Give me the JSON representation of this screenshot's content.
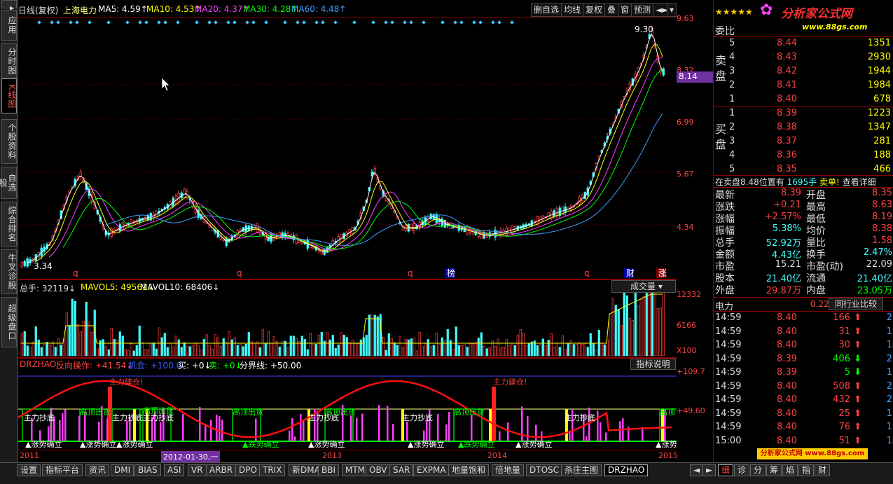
{
  "leftbar": [
    {
      "label": "应用"
    },
    {
      "label": "分时图"
    },
    {
      "label": "K线图"
    },
    {
      "label": "个股资料"
    },
    {
      "label": "自选股"
    },
    {
      "label": "综合排名"
    },
    {
      "label": "牛叉诊股"
    },
    {
      "label": "超级盘口"
    }
  ],
  "header": {
    "period": "日线(复权)",
    "stock": "上海电力",
    "ma": [
      {
        "text": "MA5: 4.59↑",
        "color": "#ffffff"
      },
      {
        "text": "MA10: 4.53↑",
        "color": "#ffff00"
      },
      {
        "text": "MA20: 4.37↑",
        "color": "#ff40ff"
      },
      {
        "text": "MA30: 4.28↑",
        "color": "#00ff00"
      },
      {
        "text": "MA60: 4.48↑",
        "color": "#40a0ff"
      }
    ],
    "buttons": [
      "删自选",
      "均线",
      "复权",
      "叠",
      "窗",
      "预测"
    ]
  },
  "main_axis": [
    "9.63",
    "8.32",
    "6.99",
    "5.67",
    "4.34"
  ],
  "current_price_tag": "8.14",
  "max_label": "9.30",
  "min_label": "3.34",
  "markers": [
    "q",
    "q",
    "q",
    "榜",
    "q",
    "财",
    "涨"
  ],
  "volume": {
    "title_total": "总手: 32119↓",
    "mavol5": "MAVOL5: 49561↓",
    "mavol10": "MAVOL10: 68406↓",
    "selector": "成交量",
    "axis": [
      "12332",
      "6166",
      "X100"
    ]
  },
  "indicator": {
    "name": "DRZHAO",
    "op": "反向操作: +41.54↓",
    "opp": "机会: +100.0",
    "buy": "买: +0↓",
    "sell": "卖: +0↓",
    "boundary": "分界线: +50.00",
    "button": "指标说明",
    "axis": [
      "+109.7",
      "+49.60"
    ],
    "labels": [
      "主力建仓!",
      "主力建仓!",
      "高顶出货",
      "高顶出货",
      "高顶出货",
      "高顶出货",
      "高顶出货",
      "高顶",
      "主力抄底",
      "主力抄底",
      "主力抄底",
      "主力抄底",
      "主力抄底",
      "主力抄底",
      "跌势确立",
      "涨势确立",
      "涨势确立",
      "跌势确立",
      "涨势确立",
      "涨势确立",
      "涨势确立",
      "涨势确立",
      "涨势"
    ]
  },
  "dates": [
    "2011",
    "2012-01-30,一",
    "2013",
    "2014",
    "2015"
  ],
  "right": {
    "logo": "分析家公式网",
    "logo_url": "www.88gs.com",
    "weibi_label": "委比",
    "sell_label": "卖盘",
    "buy_label": "买盘",
    "asks": [
      {
        "lvl": "5",
        "price": "8.44",
        "vol": "1351"
      },
      {
        "lvl": "4",
        "price": "8.43",
        "vol": "2930"
      },
      {
        "lvl": "3",
        "price": "8.42",
        "vol": "1944"
      },
      {
        "lvl": "2",
        "price": "8.41",
        "vol": "1984"
      },
      {
        "lvl": "1",
        "price": "8.40",
        "vol": "678"
      }
    ],
    "bids": [
      {
        "lvl": "1",
        "price": "8.39",
        "vol": "1223"
      },
      {
        "lvl": "2",
        "price": "8.38",
        "vol": "1347"
      },
      {
        "lvl": "3",
        "price": "8.37",
        "vol": "281"
      },
      {
        "lvl": "4",
        "price": "8.36",
        "vol": "188"
      },
      {
        "lvl": "5",
        "price": "8.35",
        "vol": "466"
      }
    ],
    "note": "在卖盘8.48位置有",
    "note_vol": "1695手",
    "note_sell": "卖单!",
    "note_link": "查看详细",
    "stats": [
      {
        "k1": "最新",
        "v1": "8.39",
        "c1": "#ff4040",
        "k2": "开盘",
        "v2": "8.35",
        "c2": "#ff4040"
      },
      {
        "k1": "涨跌",
        "v1": "+0.21",
        "c1": "#ff4040",
        "k2": "最高",
        "v2": "8.63",
        "c2": "#ff4040"
      },
      {
        "k1": "涨幅",
        "v1": "+2.57%",
        "c1": "#ff4040",
        "k2": "最低",
        "v2": "8.19",
        "c2": "#ff4040"
      },
      {
        "k1": "振幅",
        "v1": "5.38%",
        "c1": "#40ffff",
        "k2": "均价",
        "v2": "8.38",
        "c2": "#ff4040"
      },
      {
        "k1": "总手",
        "v1": "52.92万",
        "c1": "#40ffff",
        "k2": "量比",
        "v2": "1.58",
        "c2": "#ff4040"
      },
      {
        "k1": "金额",
        "v1": "4.43亿",
        "c1": "#40ffff",
        "k2": "换手",
        "v2": "2.47%",
        "c2": "#40ffff"
      },
      {
        "k1": "市盈",
        "v1": "15.21",
        "c1": "#dddddd",
        "k2": "市盈(动)",
        "v2": "22.09",
        "c2": "#dddddd"
      },
      {
        "k1": "股本",
        "v1": "21.40亿",
        "c1": "#40ffff",
        "k2": "流通",
        "v2": "21.40亿",
        "c2": "#40ffff"
      },
      {
        "k1": "外盘",
        "v1": "29.87万",
        "c1": "#ff4040",
        "k2": "内盘",
        "v2": "23.05万",
        "c2": "#00ff00"
      }
    ],
    "industry": "电力",
    "industry_pct": "0.22%",
    "industry_btn": "同行业比较",
    "ticks": [
      {
        "t": "14:59",
        "p": "8.40",
        "v": "166",
        "d": "up",
        "n": "2"
      },
      {
        "t": "14:59",
        "p": "8.40",
        "v": "31",
        "d": "up",
        "n": "1"
      },
      {
        "t": "14:59",
        "p": "8.40",
        "v": "30",
        "d": "up",
        "n": "1"
      },
      {
        "t": "14:59",
        "p": "8.39",
        "v": "406",
        "d": "down",
        "n": "2"
      },
      {
        "t": "14:59",
        "p": "8.39",
        "v": "5",
        "d": "down",
        "n": "1"
      },
      {
        "t": "14:59",
        "p": "8.40",
        "v": "508",
        "d": "up",
        "n": "2"
      },
      {
        "t": "14:59",
        "p": "8.40",
        "v": "432",
        "d": "up",
        "n": "2"
      },
      {
        "t": "14:59",
        "p": "8.40",
        "v": "25",
        "d": "up",
        "n": "1"
      },
      {
        "t": "14:59",
        "p": "8.40",
        "v": "76",
        "d": "up",
        "n": "1"
      },
      {
        "t": "15:00",
        "p": "8.40",
        "v": "51",
        "d": "up",
        "n": "1"
      }
    ],
    "watermark": "分析家公式网 www.88gs.com"
  },
  "bottom_tabs": [
    "设置",
    "指标平台",
    "资讯",
    "DMI",
    "BIAS",
    "ASI",
    "VR",
    "ARBR",
    "DPO",
    "TRIX",
    "新DMA",
    "BBI",
    "MTM",
    "OBV",
    "SAR",
    "EXPMA",
    "地量饱和",
    "倍地量",
    "DTOSC",
    "杀庄主图",
    "DRZHAO"
  ],
  "bottom_right_tabs": [
    "细",
    "诊",
    "分",
    "筹",
    "焰",
    "指",
    "财"
  ]
}
